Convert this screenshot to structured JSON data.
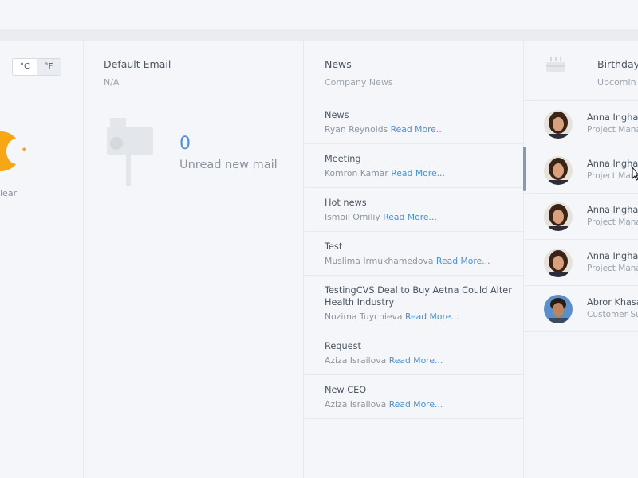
{
  "weather": {
    "units": [
      "°C",
      "°F"
    ],
    "active_unit": "°F",
    "condition_fragment": "lear"
  },
  "email": {
    "title": "Default Email",
    "address": "N/A",
    "unread_count": "0",
    "unread_label": "Unread new mail"
  },
  "news": {
    "title": "News",
    "subtitle": "Company News",
    "read_more": "Read More...",
    "items": [
      {
        "title": "News",
        "author": "Ryan Reynolds"
      },
      {
        "title": "Meeting",
        "author": "Komron Kamar"
      },
      {
        "title": "Hot news",
        "author": "Ismoil Omiliy"
      },
      {
        "title": "Test",
        "author": "Muslima Irmukhamedova"
      },
      {
        "title": "TestingCVS Deal to Buy Aetna Could Alter Health Industry",
        "author": "Nozima Tuychieva"
      },
      {
        "title": "Request",
        "author": "Aziza Israilova"
      },
      {
        "title": "New CEO",
        "author": "Aziza Israilova"
      }
    ]
  },
  "birthdays": {
    "title": "Birthday",
    "subtitle": "Upcomin",
    "people": [
      {
        "name": "Anna Inghar",
        "role": "Project Mana"
      },
      {
        "name": "Anna Inghar",
        "role": "Project Mana"
      },
      {
        "name": "Anna Inghar",
        "role": "Project Mana"
      },
      {
        "name": "Anna Inghar",
        "role": "Project Mana"
      },
      {
        "name": "Abror Khasa",
        "role": "Customer Su"
      }
    ]
  },
  "colors": {
    "accent": "#4a8fd8",
    "moon": "#f7a614",
    "background": "#f4f6f9"
  }
}
